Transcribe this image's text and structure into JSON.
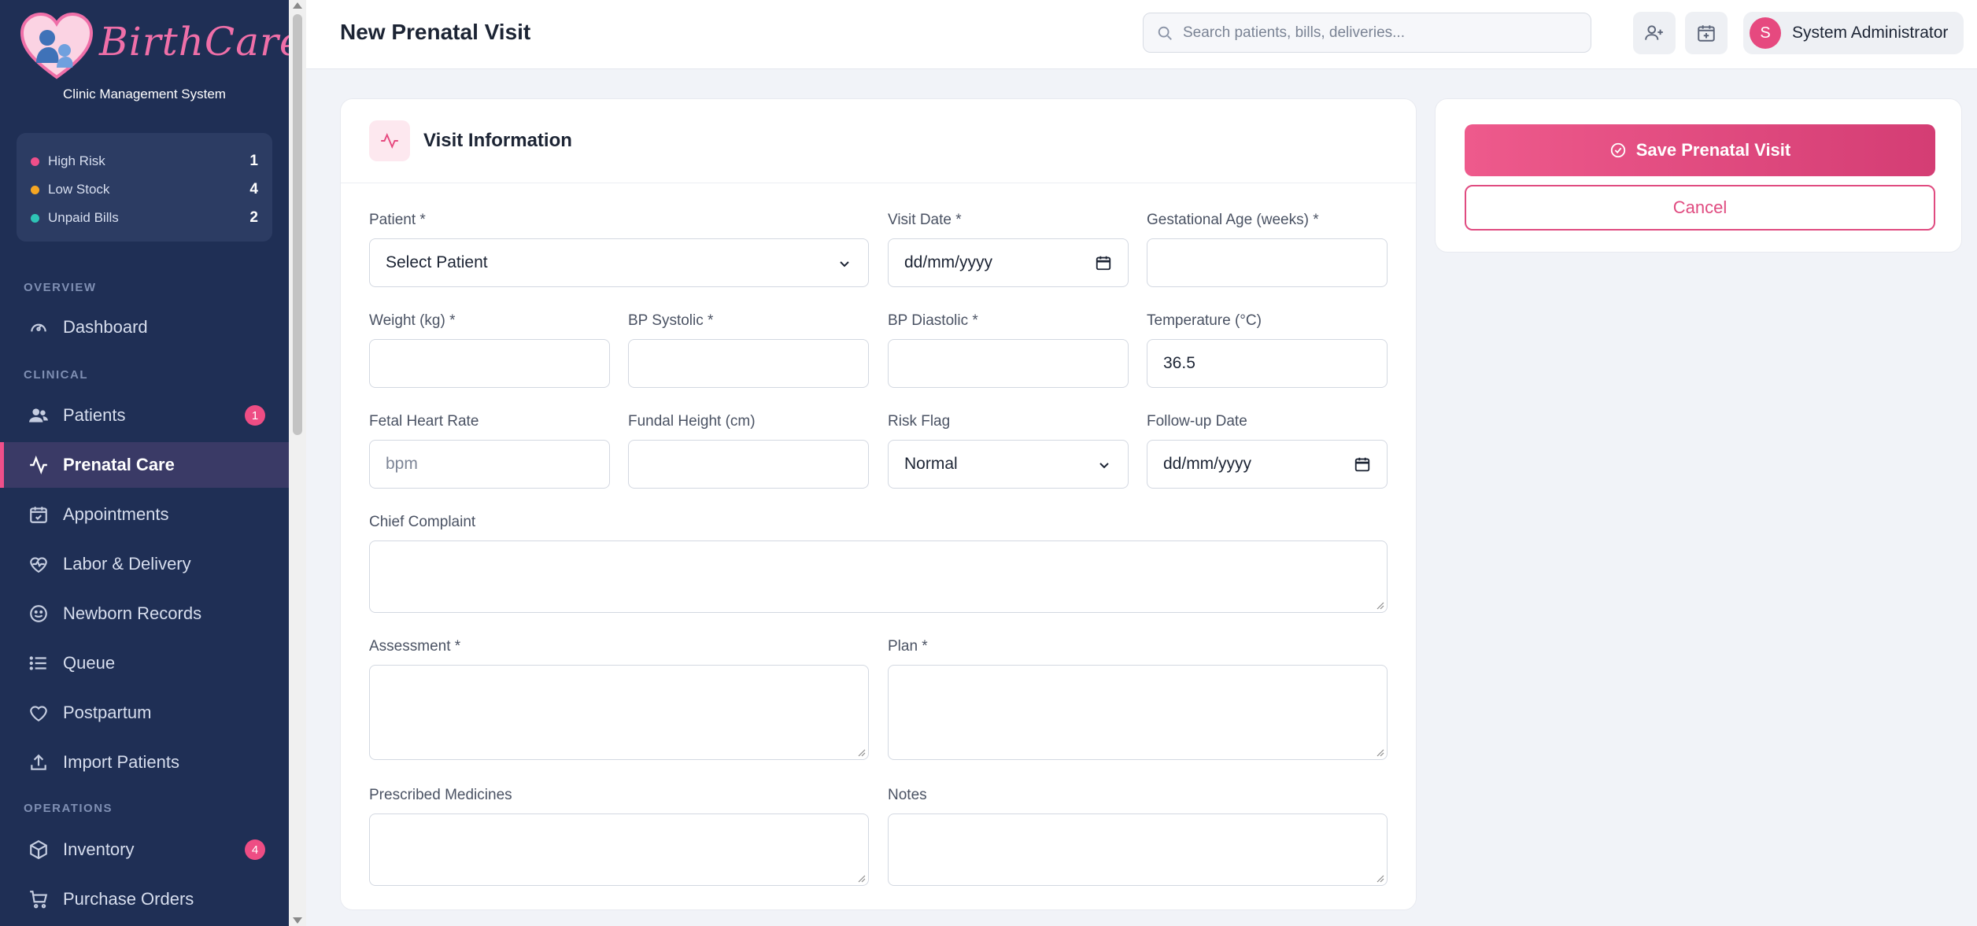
{
  "brand": {
    "name": "BirthCare",
    "subtitle": "Clinic Management System"
  },
  "alerts": [
    {
      "label": "High Risk",
      "count": "1",
      "color": "#ef4f8a"
    },
    {
      "label": "Low Stock",
      "count": "4",
      "color": "#f5a623"
    },
    {
      "label": "Unpaid Bills",
      "count": "2",
      "color": "#2ec4b6"
    }
  ],
  "sidebar": {
    "sections": {
      "overview": "OVERVIEW",
      "clinical": "CLINICAL",
      "operations": "OPERATIONS"
    },
    "items": [
      {
        "label": "Dashboard",
        "icon": "gauge-icon"
      },
      {
        "label": "Patients",
        "icon": "users-icon",
        "badge": "1"
      },
      {
        "label": "Prenatal Care",
        "icon": "activity-icon",
        "active": true
      },
      {
        "label": "Appointments",
        "icon": "calendar-check-icon"
      },
      {
        "label": "Labor & Delivery",
        "icon": "heart-pulse-icon"
      },
      {
        "label": "Newborn Records",
        "icon": "smile-icon"
      },
      {
        "label": "Queue",
        "icon": "list-icon"
      },
      {
        "label": "Postpartum",
        "icon": "heart-icon"
      },
      {
        "label": "Import Patients",
        "icon": "upload-icon"
      },
      {
        "label": "Inventory",
        "icon": "box-icon",
        "badge": "4"
      },
      {
        "label": "Purchase Orders",
        "icon": "cart-icon"
      }
    ]
  },
  "header": {
    "title": "New Prenatal Visit",
    "search_placeholder": "Search patients, bills, deliveries...",
    "user": {
      "initial": "S",
      "name": "System Administrator"
    }
  },
  "form": {
    "title": "Visit Information",
    "fields": {
      "patient": {
        "label": "Patient *",
        "value": "Select Patient"
      },
      "visit_date": {
        "label": "Visit Date *",
        "value": "dd/mm/yyyy"
      },
      "gestational_age": {
        "label": "Gestational Age (weeks) *",
        "value": ""
      },
      "weight": {
        "label": "Weight (kg) *",
        "value": ""
      },
      "bp_systolic": {
        "label": "BP Systolic *",
        "value": ""
      },
      "bp_diastolic": {
        "label": "BP Diastolic *",
        "value": ""
      },
      "temperature": {
        "label": "Temperature (°C)",
        "value": "36.5"
      },
      "fetal_heart_rate": {
        "label": "Fetal Heart Rate",
        "placeholder": "bpm"
      },
      "fundal_height": {
        "label": "Fundal Height (cm)",
        "value": ""
      },
      "risk_flag": {
        "label": "Risk Flag",
        "value": "Normal"
      },
      "follow_up_date": {
        "label": "Follow-up Date",
        "value": "dd/mm/yyyy"
      },
      "chief_complaint": {
        "label": "Chief Complaint",
        "value": ""
      },
      "assessment": {
        "label": "Assessment *",
        "value": ""
      },
      "plan": {
        "label": "Plan *",
        "value": ""
      },
      "prescribed_medicines": {
        "label": "Prescribed Medicines",
        "value": ""
      },
      "notes": {
        "label": "Notes",
        "value": ""
      }
    }
  },
  "actions": {
    "save_label": "Save Prenatal Visit",
    "cancel_label": "Cancel"
  },
  "colors": {
    "sidebar_bg": "#1f2f55",
    "accent": "#e6497f",
    "page_bg": "#f1f3f8"
  }
}
